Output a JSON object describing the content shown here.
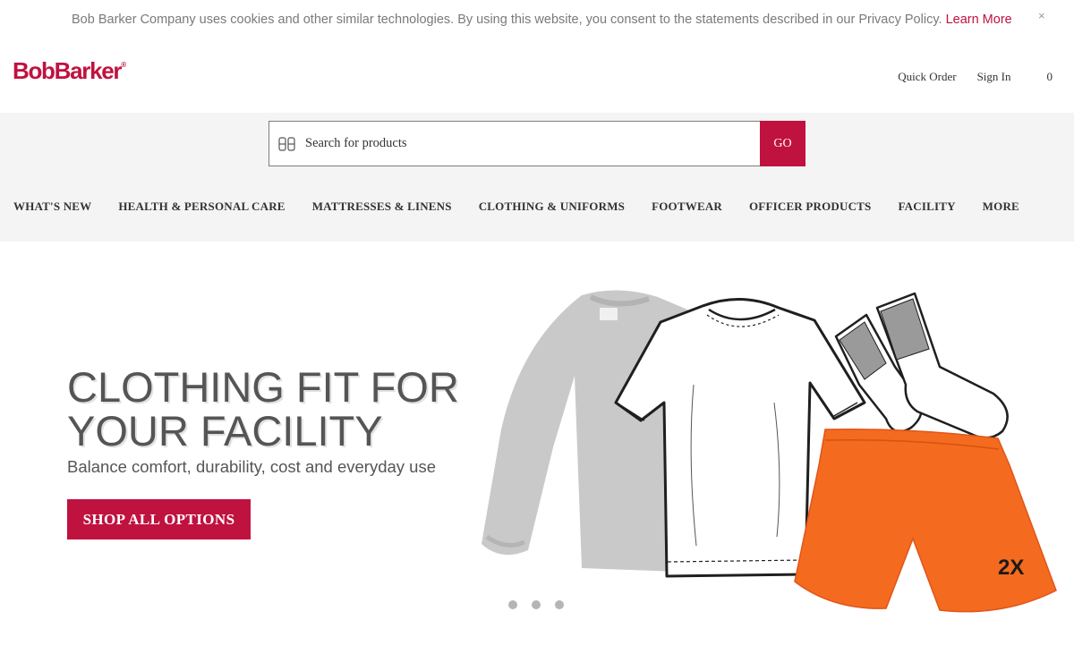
{
  "cookie_banner": {
    "text": "Bob Barker Company uses cookies and other similar technologies. By using this website, you consent to the statements described in our Privacy Policy.",
    "link": "Learn More",
    "close": "×"
  },
  "header": {
    "logo": "BobBarker",
    "logo_mark": "®",
    "quick_order": "Quick Order",
    "sign_in": "Sign In",
    "cart_count": "0"
  },
  "search": {
    "placeholder": "Search for products",
    "button": "GO"
  },
  "nav": {
    "items": [
      "WHAT'S NEW",
      "HEALTH & PERSONAL CARE",
      "MATTRESSES & LINENS",
      "CLOTHING & UNIFORMS",
      "FOOTWEAR",
      "OFFICER PRODUCTS",
      "FACILITY",
      "MORE"
    ]
  },
  "hero": {
    "title_line1": "CLOTHING FIT FOR",
    "title_line2": "YOUR FACILITY",
    "subtitle": "Balance comfort, durability, cost and everyday use",
    "cta": "SHOP ALL OPTIONS",
    "shorts_size_label": "2X",
    "slide_count": 3
  },
  "colors": {
    "brand": "#c0123f",
    "band_bg": "#f4f4f4",
    "shorts": "#f46a1f",
    "sweatshirt": "#c9c9c9"
  }
}
